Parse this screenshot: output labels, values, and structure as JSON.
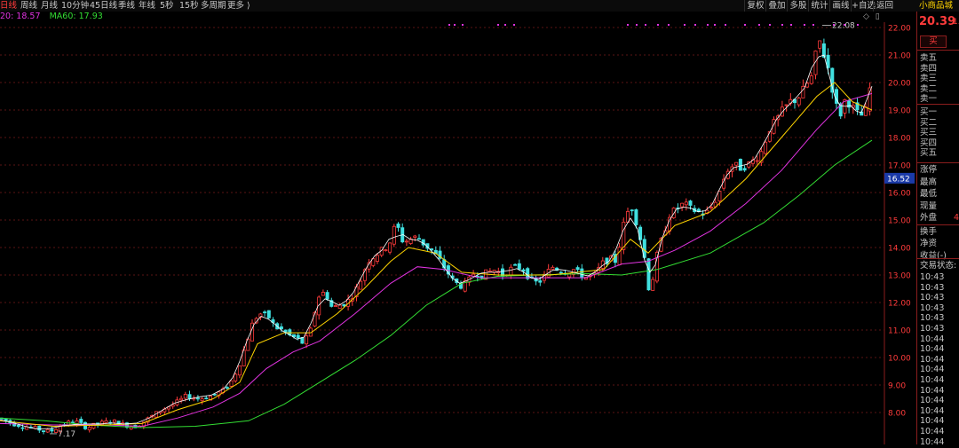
{
  "toolbar": {
    "periods": [
      "日线",
      "周线",
      "月线",
      "10分钟",
      "45日线",
      "季线",
      "年线",
      "5秒",
      "15秒",
      "多周期",
      "更多 ⟩"
    ],
    "active_period": "日线",
    "right_buttons": [
      "复权",
      "叠加",
      "多股",
      "统计",
      "画线",
      "+自选",
      "返回"
    ],
    "stock_name": "小商品城",
    "icon_names": [
      "diamond-icon",
      "window-icon"
    ]
  },
  "ma_legend": [
    {
      "label": "20: 18.57",
      "color": "#e033e0"
    },
    {
      "label": "MA60: 17.93",
      "color": "#33dd33"
    }
  ],
  "chart_labels": {
    "high_marker": "22.08",
    "low_marker": "7.17",
    "current_price_tag": "16.52"
  },
  "chart_data": {
    "type": "candlestick",
    "y_ticks": [
      "22.00",
      "21.00",
      "20.00",
      "19.00",
      "18.00",
      "17.00",
      "16.00",
      "15.00",
      "14.00",
      "13.00",
      "12.00",
      "11.00",
      "10.00",
      "9.00",
      "8.00"
    ],
    "ylim": [
      7.4,
      22.3
    ],
    "high": 22.08,
    "low": 7.17,
    "current_price_tag": 16.52,
    "colors": {
      "up": "#ff3b3b",
      "down": "#40e0e0",
      "ma5": "#ffffff",
      "ma10": "#ffd400",
      "ma20": "#e033e0",
      "ma60": "#33dd33"
    },
    "price_path": [
      [
        0,
        7.8
      ],
      [
        14,
        7.6
      ],
      [
        28,
        7.5
      ],
      [
        42,
        7.4
      ],
      [
        56,
        7.3
      ],
      [
        70,
        7.55
      ],
      [
        84,
        7.7
      ],
      [
        98,
        7.45
      ],
      [
        112,
        7.6
      ],
      [
        126,
        7.7
      ],
      [
        140,
        7.55
      ],
      [
        154,
        7.5
      ],
      [
        168,
        7.8
      ],
      [
        182,
        8.1
      ],
      [
        196,
        8.3
      ],
      [
        210,
        8.6
      ],
      [
        224,
        8.5
      ],
      [
        238,
        8.6
      ],
      [
        252,
        8.8
      ],
      [
        262,
        9.2
      ],
      [
        270,
        9.8
      ],
      [
        278,
        10.6
      ],
      [
        286,
        11.4
      ],
      [
        294,
        11.6
      ],
      [
        302,
        11.5
      ],
      [
        310,
        11.1
      ],
      [
        318,
        11.0
      ],
      [
        326,
        10.8
      ],
      [
        334,
        10.7
      ],
      [
        342,
        10.5
      ],
      [
        350,
        11.0
      ],
      [
        358,
        12.2
      ],
      [
        366,
        12.4
      ],
      [
        374,
        11.8
      ],
      [
        382,
        11.9
      ],
      [
        390,
        12.0
      ],
      [
        398,
        12.3
      ],
      [
        406,
        12.8
      ],
      [
        414,
        13.5
      ],
      [
        422,
        13.7
      ],
      [
        430,
        13.9
      ],
      [
        438,
        14.1
      ],
      [
        446,
        14.9
      ],
      [
        454,
        14.2
      ],
      [
        462,
        14.3
      ],
      [
        470,
        14.4
      ],
      [
        478,
        14.1
      ],
      [
        486,
        13.9
      ],
      [
        494,
        13.6
      ],
      [
        502,
        13.2
      ],
      [
        510,
        12.8
      ],
      [
        518,
        12.6
      ],
      [
        526,
        12.7
      ],
      [
        534,
        13.1
      ],
      [
        542,
        13.0
      ],
      [
        550,
        13.1
      ],
      [
        558,
        13.2
      ],
      [
        566,
        13.0
      ],
      [
        574,
        13.2
      ],
      [
        582,
        13.3
      ],
      [
        590,
        13.2
      ],
      [
        598,
        12.8
      ],
      [
        606,
        12.7
      ],
      [
        614,
        13.0
      ],
      [
        622,
        13.3
      ],
      [
        630,
        13.2
      ],
      [
        638,
        13.1
      ],
      [
        646,
        13.2
      ],
      [
        654,
        13.0
      ],
      [
        662,
        12.9
      ],
      [
        670,
        13.0
      ],
      [
        678,
        13.4
      ],
      [
        686,
        13.6
      ],
      [
        694,
        13.5
      ],
      [
        702,
        14.8
      ],
      [
        710,
        15.6
      ],
      [
        718,
        14.8
      ],
      [
        726,
        13.6
      ],
      [
        732,
        12.2
      ],
      [
        738,
        13.5
      ],
      [
        746,
        14.4
      ],
      [
        754,
        15.2
      ],
      [
        762,
        15.4
      ],
      [
        770,
        15.6
      ],
      [
        778,
        15.4
      ],
      [
        786,
        15.3
      ],
      [
        794,
        15.2
      ],
      [
        802,
        15.5
      ],
      [
        810,
        16.0
      ],
      [
        818,
        16.8
      ],
      [
        826,
        17.0
      ],
      [
        834,
        16.9
      ],
      [
        842,
        17.0
      ],
      [
        850,
        17.2
      ],
      [
        858,
        17.5
      ],
      [
        866,
        18.3
      ],
      [
        874,
        18.6
      ],
      [
        882,
        19.0
      ],
      [
        890,
        19.3
      ],
      [
        898,
        19.4
      ],
      [
        906,
        19.8
      ],
      [
        914,
        20.2
      ],
      [
        922,
        21.6
      ],
      [
        928,
        21.0
      ],
      [
        934,
        20.4
      ],
      [
        940,
        19.3
      ],
      [
        946,
        18.8
      ],
      [
        952,
        19.4
      ],
      [
        958,
        19.2
      ],
      [
        964,
        18.9
      ],
      [
        970,
        18.8
      ],
      [
        976,
        19.0
      ],
      [
        982,
        20.3
      ]
    ],
    "ma10_path": [
      [
        0,
        7.7
      ],
      [
        60,
        7.5
      ],
      [
        120,
        7.55
      ],
      [
        160,
        7.6
      ],
      [
        200,
        8.1
      ],
      [
        240,
        8.5
      ],
      [
        270,
        9.1
      ],
      [
        290,
        10.5
      ],
      [
        320,
        10.9
      ],
      [
        350,
        10.9
      ],
      [
        380,
        11.6
      ],
      [
        410,
        12.5
      ],
      [
        440,
        13.5
      ],
      [
        460,
        14.0
      ],
      [
        490,
        13.8
      ],
      [
        520,
        13.1
      ],
      [
        560,
        13.0
      ],
      [
        620,
        13.0
      ],
      [
        680,
        13.2
      ],
      [
        710,
        14.3
      ],
      [
        730,
        13.8
      ],
      [
        760,
        14.8
      ],
      [
        800,
        15.3
      ],
      [
        840,
        16.5
      ],
      [
        880,
        18.0
      ],
      [
        920,
        19.5
      ],
      [
        940,
        20.0
      ],
      [
        960,
        19.3
      ],
      [
        982,
        19.0
      ]
    ],
    "ma20_path": [
      [
        0,
        7.6
      ],
      [
        60,
        7.55
      ],
      [
        120,
        7.55
      ],
      [
        160,
        7.5
      ],
      [
        200,
        7.8
      ],
      [
        240,
        8.2
      ],
      [
        270,
        8.7
      ],
      [
        300,
        9.6
      ],
      [
        330,
        10.2
      ],
      [
        360,
        10.6
      ],
      [
        400,
        11.6
      ],
      [
        440,
        12.7
      ],
      [
        470,
        13.3
      ],
      [
        500,
        13.2
      ],
      [
        540,
        12.9
      ],
      [
        600,
        12.9
      ],
      [
        660,
        12.9
      ],
      [
        700,
        13.4
      ],
      [
        730,
        13.5
      ],
      [
        760,
        13.9
      ],
      [
        800,
        14.6
      ],
      [
        840,
        15.6
      ],
      [
        880,
        16.8
      ],
      [
        920,
        18.3
      ],
      [
        950,
        19.3
      ],
      [
        982,
        19.6
      ]
    ],
    "ma60_path": [
      [
        0,
        7.8
      ],
      [
        50,
        7.7
      ],
      [
        100,
        7.55
      ],
      [
        160,
        7.45
      ],
      [
        220,
        7.5
      ],
      [
        280,
        7.7
      ],
      [
        320,
        8.3
      ],
      [
        360,
        9.1
      ],
      [
        400,
        9.9
      ],
      [
        440,
        10.8
      ],
      [
        480,
        11.9
      ],
      [
        520,
        12.7
      ],
      [
        560,
        12.95
      ],
      [
        600,
        13.0
      ],
      [
        660,
        13.05
      ],
      [
        700,
        13.0
      ],
      [
        740,
        13.2
      ],
      [
        800,
        13.8
      ],
      [
        860,
        14.9
      ],
      [
        900,
        15.9
      ],
      [
        940,
        17.0
      ],
      [
        982,
        17.9
      ]
    ]
  },
  "quote_panel": {
    "price": "20.39",
    "change_partial": "1.",
    "buy_label": "买",
    "order_book": [
      "卖五",
      "卖四",
      "卖三",
      "卖二",
      "卖一",
      "买一",
      "买二",
      "买三",
      "买四",
      "买五"
    ],
    "stats": [
      "涨停",
      "最高",
      "最低",
      "现量",
      "外盘",
      "换手",
      "净资",
      "收益(-)"
    ],
    "partial_value": "4",
    "trade_state_label": "交易状态: ",
    "ticks": [
      "10:43",
      "10:43",
      "10:43",
      "10:43",
      "10:43",
      "10:43",
      "10:44",
      "10:44",
      "10:44",
      "10:44",
      "10:44",
      "10:44",
      "10:44",
      "10:44",
      "10:44",
      "10:44",
      "10:44"
    ]
  }
}
